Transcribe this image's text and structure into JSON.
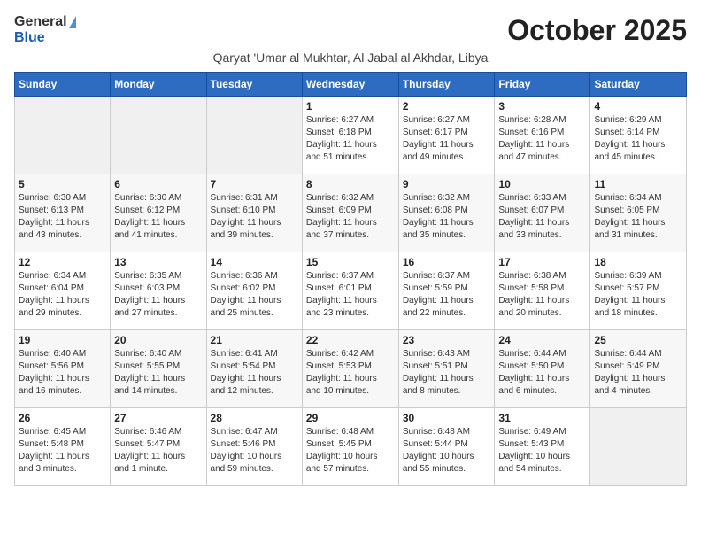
{
  "header": {
    "logo_general": "General",
    "logo_blue": "Blue",
    "month_title": "October 2025",
    "subtitle": "Qaryat 'Umar al Mukhtar, Al Jabal al Akhdar, Libya"
  },
  "weekdays": [
    "Sunday",
    "Monday",
    "Tuesday",
    "Wednesday",
    "Thursday",
    "Friday",
    "Saturday"
  ],
  "weeks": [
    [
      {
        "day": "",
        "info": ""
      },
      {
        "day": "",
        "info": ""
      },
      {
        "day": "",
        "info": ""
      },
      {
        "day": "1",
        "info": "Sunrise: 6:27 AM\nSunset: 6:18 PM\nDaylight: 11 hours\nand 51 minutes."
      },
      {
        "day": "2",
        "info": "Sunrise: 6:27 AM\nSunset: 6:17 PM\nDaylight: 11 hours\nand 49 minutes."
      },
      {
        "day": "3",
        "info": "Sunrise: 6:28 AM\nSunset: 6:16 PM\nDaylight: 11 hours\nand 47 minutes."
      },
      {
        "day": "4",
        "info": "Sunrise: 6:29 AM\nSunset: 6:14 PM\nDaylight: 11 hours\nand 45 minutes."
      }
    ],
    [
      {
        "day": "5",
        "info": "Sunrise: 6:30 AM\nSunset: 6:13 PM\nDaylight: 11 hours\nand 43 minutes."
      },
      {
        "day": "6",
        "info": "Sunrise: 6:30 AM\nSunset: 6:12 PM\nDaylight: 11 hours\nand 41 minutes."
      },
      {
        "day": "7",
        "info": "Sunrise: 6:31 AM\nSunset: 6:10 PM\nDaylight: 11 hours\nand 39 minutes."
      },
      {
        "day": "8",
        "info": "Sunrise: 6:32 AM\nSunset: 6:09 PM\nDaylight: 11 hours\nand 37 minutes."
      },
      {
        "day": "9",
        "info": "Sunrise: 6:32 AM\nSunset: 6:08 PM\nDaylight: 11 hours\nand 35 minutes."
      },
      {
        "day": "10",
        "info": "Sunrise: 6:33 AM\nSunset: 6:07 PM\nDaylight: 11 hours\nand 33 minutes."
      },
      {
        "day": "11",
        "info": "Sunrise: 6:34 AM\nSunset: 6:05 PM\nDaylight: 11 hours\nand 31 minutes."
      }
    ],
    [
      {
        "day": "12",
        "info": "Sunrise: 6:34 AM\nSunset: 6:04 PM\nDaylight: 11 hours\nand 29 minutes."
      },
      {
        "day": "13",
        "info": "Sunrise: 6:35 AM\nSunset: 6:03 PM\nDaylight: 11 hours\nand 27 minutes."
      },
      {
        "day": "14",
        "info": "Sunrise: 6:36 AM\nSunset: 6:02 PM\nDaylight: 11 hours\nand 25 minutes."
      },
      {
        "day": "15",
        "info": "Sunrise: 6:37 AM\nSunset: 6:01 PM\nDaylight: 11 hours\nand 23 minutes."
      },
      {
        "day": "16",
        "info": "Sunrise: 6:37 AM\nSunset: 5:59 PM\nDaylight: 11 hours\nand 22 minutes."
      },
      {
        "day": "17",
        "info": "Sunrise: 6:38 AM\nSunset: 5:58 PM\nDaylight: 11 hours\nand 20 minutes."
      },
      {
        "day": "18",
        "info": "Sunrise: 6:39 AM\nSunset: 5:57 PM\nDaylight: 11 hours\nand 18 minutes."
      }
    ],
    [
      {
        "day": "19",
        "info": "Sunrise: 6:40 AM\nSunset: 5:56 PM\nDaylight: 11 hours\nand 16 minutes."
      },
      {
        "day": "20",
        "info": "Sunrise: 6:40 AM\nSunset: 5:55 PM\nDaylight: 11 hours\nand 14 minutes."
      },
      {
        "day": "21",
        "info": "Sunrise: 6:41 AM\nSunset: 5:54 PM\nDaylight: 11 hours\nand 12 minutes."
      },
      {
        "day": "22",
        "info": "Sunrise: 6:42 AM\nSunset: 5:53 PM\nDaylight: 11 hours\nand 10 minutes."
      },
      {
        "day": "23",
        "info": "Sunrise: 6:43 AM\nSunset: 5:51 PM\nDaylight: 11 hours\nand 8 minutes."
      },
      {
        "day": "24",
        "info": "Sunrise: 6:44 AM\nSunset: 5:50 PM\nDaylight: 11 hours\nand 6 minutes."
      },
      {
        "day": "25",
        "info": "Sunrise: 6:44 AM\nSunset: 5:49 PM\nDaylight: 11 hours\nand 4 minutes."
      }
    ],
    [
      {
        "day": "26",
        "info": "Sunrise: 6:45 AM\nSunset: 5:48 PM\nDaylight: 11 hours\nand 3 minutes."
      },
      {
        "day": "27",
        "info": "Sunrise: 6:46 AM\nSunset: 5:47 PM\nDaylight: 11 hours\nand 1 minute."
      },
      {
        "day": "28",
        "info": "Sunrise: 6:47 AM\nSunset: 5:46 PM\nDaylight: 10 hours\nand 59 minutes."
      },
      {
        "day": "29",
        "info": "Sunrise: 6:48 AM\nSunset: 5:45 PM\nDaylight: 10 hours\nand 57 minutes."
      },
      {
        "day": "30",
        "info": "Sunrise: 6:48 AM\nSunset: 5:44 PM\nDaylight: 10 hours\nand 55 minutes."
      },
      {
        "day": "31",
        "info": "Sunrise: 6:49 AM\nSunset: 5:43 PM\nDaylight: 10 hours\nand 54 minutes."
      },
      {
        "day": "",
        "info": ""
      }
    ]
  ]
}
